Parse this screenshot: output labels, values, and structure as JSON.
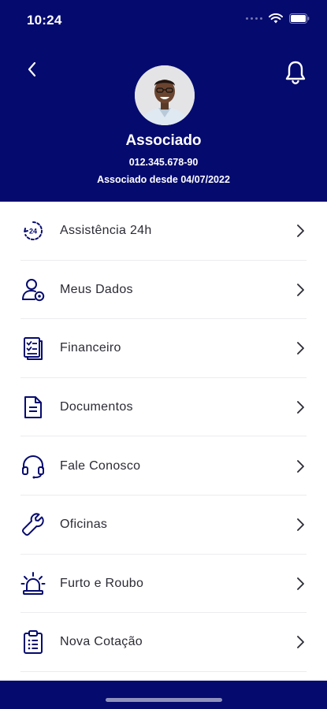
{
  "status_bar": {
    "time": "10:24"
  },
  "colors": {
    "primary": "#050a6e",
    "text": "#2b2b35",
    "divider": "#ececf0"
  },
  "profile": {
    "name": "Associado",
    "id_number": "012.345.678-90",
    "member_since": "Associado desde 04/07/2022"
  },
  "menu": {
    "items": [
      {
        "label": "Assistência 24h",
        "icon": "assistance-24h-icon"
      },
      {
        "label": "Meus Dados",
        "icon": "user-settings-icon"
      },
      {
        "label": "Financeiro",
        "icon": "checklist-icon"
      },
      {
        "label": "Documentos",
        "icon": "document-icon"
      },
      {
        "label": "Fale Conosco",
        "icon": "headset-icon"
      },
      {
        "label": "Oficinas",
        "icon": "wrench-icon"
      },
      {
        "label": "Furto e Roubo",
        "icon": "siren-icon"
      },
      {
        "label": "Nova Cotação",
        "icon": "clipboard-list-icon"
      }
    ]
  }
}
